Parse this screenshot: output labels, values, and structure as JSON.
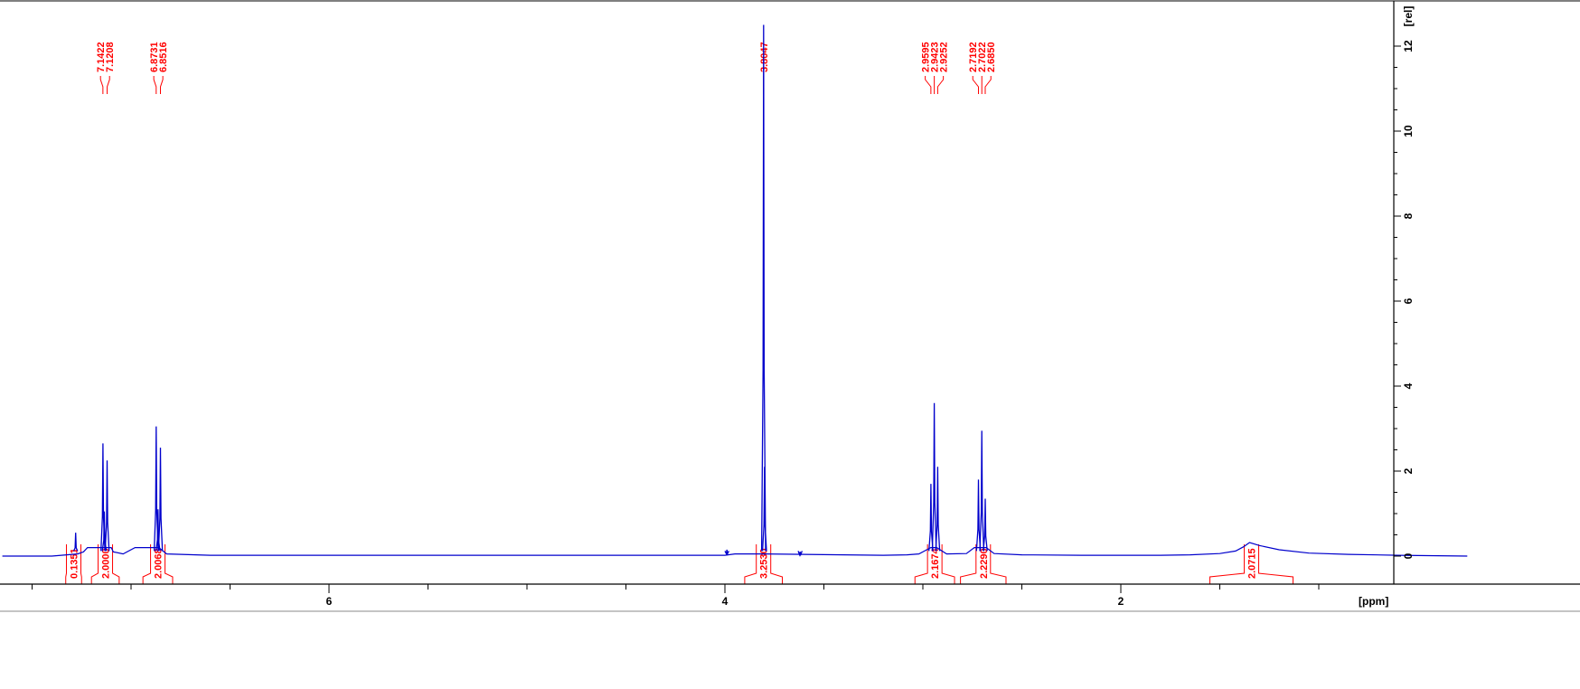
{
  "chart_data": {
    "type": "line",
    "title": "",
    "xlabel": "[ppm]",
    "ylabel": "[rel]",
    "x_reversed": true,
    "xlim": [
      7.65,
      0.25
    ],
    "ylim": [
      -0.7,
      12.7
    ],
    "grid": false,
    "x_ticks": [
      6,
      4,
      2
    ],
    "y_ticks": [
      0,
      2,
      4,
      6,
      8,
      10,
      12
    ],
    "baseline": [
      [
        7.65,
        0.0
      ],
      [
        7.4,
        0.0
      ],
      [
        7.27,
        0.05
      ],
      [
        7.24,
        0.1
      ],
      [
        7.22,
        0.2
      ],
      [
        7.1,
        0.2
      ],
      [
        7.09,
        0.1
      ],
      [
        7.04,
        0.05
      ],
      [
        6.98,
        0.2
      ],
      [
        6.86,
        0.2
      ],
      [
        6.82,
        0.05
      ],
      [
        6.6,
        0.02
      ],
      [
        5.0,
        0.02
      ],
      [
        4.0,
        0.02
      ],
      [
        3.95,
        0.05
      ],
      [
        3.8,
        0.05
      ],
      [
        3.2,
        0.02
      ],
      [
        3.08,
        0.03
      ],
      [
        3.02,
        0.05
      ],
      [
        2.96,
        0.2
      ],
      [
        2.93,
        0.2
      ],
      [
        2.88,
        0.05
      ],
      [
        2.78,
        0.06
      ],
      [
        2.74,
        0.2
      ],
      [
        2.68,
        0.2
      ],
      [
        2.64,
        0.06
      ],
      [
        2.5,
        0.03
      ],
      [
        2.2,
        0.02
      ],
      [
        1.8,
        0.02
      ],
      [
        1.65,
        0.03
      ],
      [
        1.5,
        0.06
      ],
      [
        1.42,
        0.12
      ],
      [
        1.38,
        0.22
      ],
      [
        1.35,
        0.32
      ],
      [
        1.3,
        0.25
      ],
      [
        1.2,
        0.15
      ],
      [
        1.05,
        0.07
      ],
      [
        0.85,
        0.04
      ],
      [
        0.6,
        0.02
      ],
      [
        0.25,
        0.0
      ]
    ],
    "peaks": [
      {
        "x": 7.28,
        "y": 0.55
      },
      {
        "x": 7.1422,
        "y": 2.65
      },
      {
        "x": 7.1208,
        "y": 2.25
      },
      {
        "x": 7.135,
        "y": 1.05
      },
      {
        "x": 6.8731,
        "y": 3.05
      },
      {
        "x": 6.8516,
        "y": 2.55
      },
      {
        "x": 6.864,
        "y": 1.1
      },
      {
        "x": 3.8047,
        "y": 12.5
      },
      {
        "x": 3.8,
        "y": 2.1
      },
      {
        "x": 3.99,
        "y": 0.15
      },
      {
        "x": 3.62,
        "y": 0.1
      },
      {
        "x": 2.9595,
        "y": 1.7
      },
      {
        "x": 2.9423,
        "y": 3.6
      },
      {
        "x": 2.9252,
        "y": 2.1
      },
      {
        "x": 2.7192,
        "y": 1.8
      },
      {
        "x": 2.7022,
        "y": 2.95
      },
      {
        "x": 2.685,
        "y": 1.35
      }
    ],
    "peak_labels": [
      {
        "text": "7.1422",
        "ppm": 7.1422
      },
      {
        "text": "7.1208",
        "ppm": 7.1208
      },
      {
        "text": "6.8731",
        "ppm": 6.8731
      },
      {
        "text": "6.8516",
        "ppm": 6.8516
      },
      {
        "text": "3.8047",
        "ppm": 3.8047
      },
      {
        "text": "2.9595",
        "ppm": 2.9595
      },
      {
        "text": "2.9423",
        "ppm": 2.9423
      },
      {
        "text": "2.9252",
        "ppm": 2.9252
      },
      {
        "text": "2.7192",
        "ppm": 2.7192
      },
      {
        "text": "2.7022",
        "ppm": 2.7022
      },
      {
        "text": "2.6850",
        "ppm": 2.685
      }
    ],
    "integrals": [
      {
        "text": "0.1351",
        "from": 7.33,
        "to": 7.25
      },
      {
        "text": "2.0000",
        "from": 7.2,
        "to": 7.06
      },
      {
        "text": "2.0068",
        "from": 6.94,
        "to": 6.79
      },
      {
        "text": "3.2530",
        "from": 3.9,
        "to": 3.71
      },
      {
        "text": "2.1674",
        "from": 3.04,
        "to": 2.84
      },
      {
        "text": "2.2290",
        "from": 2.81,
        "to": 2.58
      },
      {
        "text": "2.0715",
        "from": 1.55,
        "to": 1.13
      }
    ]
  },
  "colors": {
    "spectrum": "#0000cc",
    "annotation": "#ff0000",
    "axis": "#000000"
  }
}
